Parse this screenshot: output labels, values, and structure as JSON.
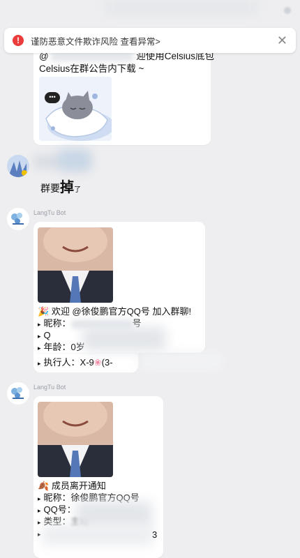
{
  "banner": {
    "text": "谨防恶意文件欺诈风险 查看异常>",
    "icon": "alert-icon",
    "close_icon": "close-icon"
  },
  "message1": {
    "line1_prefix": "@",
    "line1_suffix": "迎使用Celsius底包",
    "line2": "Celsius在群公告内下载 ~",
    "sticker": "sleeping-cat-sticker"
  },
  "message2": {
    "text_main": "群要",
    "text_big": "掉",
    "text_small": "了"
  },
  "message3": {
    "sender": "LangTu Bot",
    "icon": "party-icon",
    "welcome": "欢迎 @徐俊鹏官方QQ号 加入群聊!",
    "nickname_prefix": "昵称：",
    "nickname_tail": "号",
    "qq_prefix": "Q",
    "age": "年龄：0岁",
    "executor": "执行人：X-9",
    "executor_tail": "(3-"
  },
  "message4": {
    "sender": "LangTu Bot",
    "icon": "leaf-icon",
    "title": "成员离开通知",
    "nickname": "昵称：徐俊鹏官方QQ号",
    "qq_prefix": "QQ号：",
    "type_prefix": "类型：",
    "type_value": "主动",
    "last_tail": "3"
  },
  "colors": {
    "background": "#eeeef0",
    "bubble": "#ffffff",
    "alert": "#ec3b3b",
    "sender_name": "#9a9ea6"
  }
}
